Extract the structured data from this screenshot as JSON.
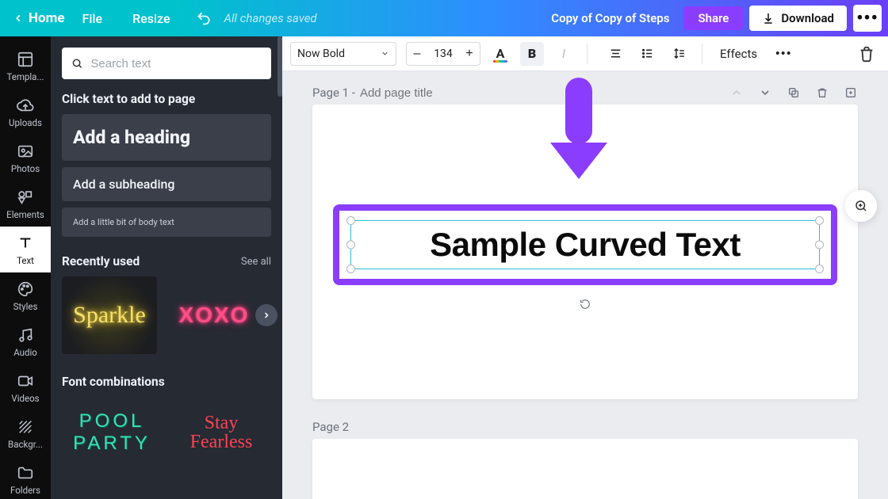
{
  "header": {
    "home": "Home",
    "file": "File",
    "resize": "Resize",
    "saved_status": "All changes saved",
    "doc_title": "Copy of Copy of Steps",
    "share": "Share",
    "download": "Download"
  },
  "rail": {
    "items": [
      {
        "label": "Templa..."
      },
      {
        "label": "Uploads"
      },
      {
        "label": "Photos"
      },
      {
        "label": "Elements"
      },
      {
        "label": "Text"
      },
      {
        "label": "Styles"
      },
      {
        "label": "Audio"
      },
      {
        "label": "Videos"
      },
      {
        "label": "Backgr..."
      },
      {
        "label": "Folders"
      }
    ],
    "active_index": 4
  },
  "panel": {
    "search_placeholder": "Search text",
    "instructions": "Click text to add to page",
    "presets": {
      "heading": "Add a heading",
      "subheading": "Add a subheading",
      "body": "Add a little bit of body text"
    },
    "recently_used_title": "Recently used",
    "see_all": "See all",
    "recent_thumbs": {
      "sparkle": "Sparkle",
      "xoxo": "XOXO"
    },
    "font_combos_title": "Font combinations",
    "combos": {
      "pool_party": "POOL\nPARTY",
      "stay_fearless": "Stay\nFearless"
    }
  },
  "toolbar": {
    "font_name": "Now Bold",
    "font_size": "134",
    "color_glyph": "A",
    "bold_glyph": "B",
    "italic_glyph": "I",
    "effects": "Effects"
  },
  "canvas": {
    "page1_label": "Page 1 - ",
    "page1_title_placeholder": "Add page title",
    "selected_text": "Sample Curved Text",
    "page2_label": "Page 2"
  },
  "colors": {
    "accent": "#8b3dff",
    "teal": "#27c4cf"
  }
}
